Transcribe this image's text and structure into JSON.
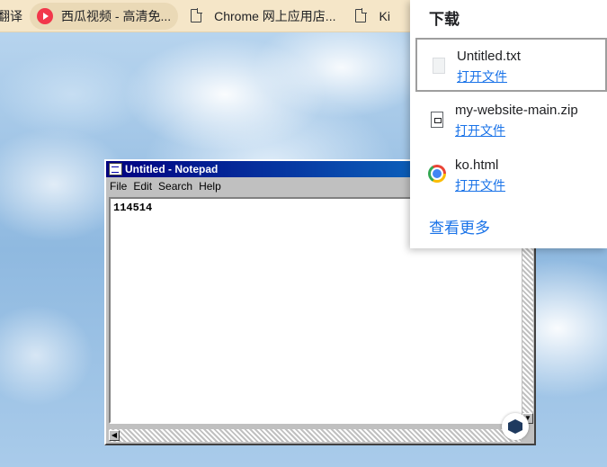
{
  "bookmarks": {
    "items": [
      {
        "label": "翻译"
      },
      {
        "label": "西瓜视频 - 高清免..."
      },
      {
        "label": "Chrome 网上应用店..."
      },
      {
        "label": "Ki"
      }
    ]
  },
  "notepad": {
    "title": "Untitled - Notepad",
    "menu": [
      "File",
      "Edit",
      "Search",
      "Help"
    ],
    "content": "114514"
  },
  "downloads": {
    "title": "下载",
    "items": [
      {
        "name": "Untitled.txt",
        "action": "打开文件",
        "icon": "file-icon"
      },
      {
        "name": "my-website-main.zip",
        "action": "打开文件",
        "icon": "zip-icon"
      },
      {
        "name": "ko.html",
        "action": "打开文件",
        "icon": "chrome-icon"
      }
    ],
    "more": "查看更多"
  },
  "colors": {
    "bookmark_bar": "#f5e6c8",
    "notepad_title": "#000080",
    "link": "#1a73e8"
  }
}
